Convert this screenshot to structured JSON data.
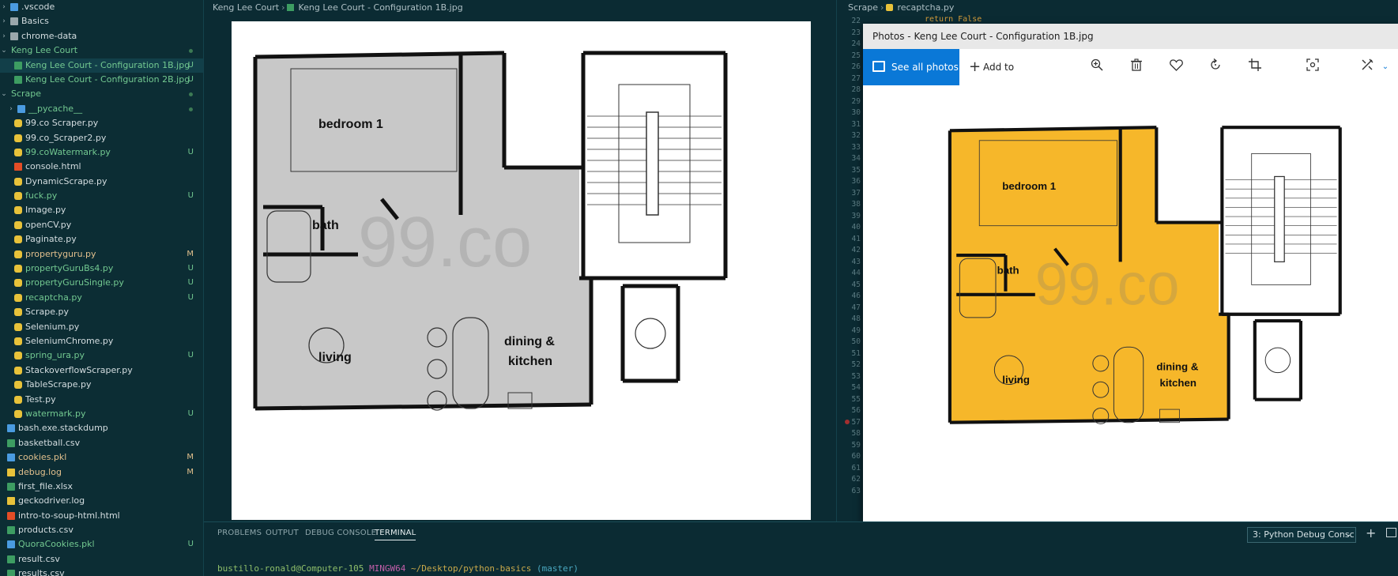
{
  "explorer": {
    "items": [
      {
        "label": ".vscode",
        "type": "folder",
        "collapsed": true,
        "indent": 0,
        "icon_color": "#4a9be0",
        "status": ""
      },
      {
        "label": "Basics",
        "type": "folder",
        "collapsed": true,
        "indent": 0,
        "icon_color": "#9aa7ab",
        "status": ""
      },
      {
        "label": "chrome-data",
        "type": "folder",
        "collapsed": true,
        "indent": 0,
        "icon_color": "#9aa7ab",
        "status": ""
      },
      {
        "label": "Keng Lee Court",
        "type": "folder",
        "collapsed": false,
        "indent": 0,
        "icon_color": "",
        "status": "dot"
      },
      {
        "label": "Keng Lee Court - Configuration 1B.jpg",
        "type": "image",
        "indent": 1,
        "icon_color": "#3d9d62",
        "status": "U",
        "selected": true
      },
      {
        "label": "Keng Lee Court - Configuration 2B.jpg",
        "type": "image",
        "indent": 1,
        "icon_color": "#3d9d62",
        "status": "U"
      },
      {
        "label": "Scrape",
        "type": "folder",
        "collapsed": false,
        "indent": 0,
        "icon_color": "",
        "status": "dot"
      },
      {
        "label": "__pycache__",
        "type": "folder",
        "collapsed": true,
        "indent": 1,
        "icon_color": "#4a9be0",
        "status": "dot"
      },
      {
        "label": "99.co Scraper.py",
        "type": "py",
        "indent": 1,
        "icon_color": "#e8c23a",
        "status": ""
      },
      {
        "label": "99.co_Scraper2.py",
        "type": "py",
        "indent": 1,
        "icon_color": "#e8c23a",
        "status": ""
      },
      {
        "label": "99.coWatermark.py",
        "type": "py",
        "indent": 1,
        "icon_color": "#e8c23a",
        "status": "U"
      },
      {
        "label": "console.html",
        "type": "html",
        "indent": 1,
        "icon_color": "#e44d26",
        "status": ""
      },
      {
        "label": "DynamicScrape.py",
        "type": "py",
        "indent": 1,
        "icon_color": "#e8c23a",
        "status": ""
      },
      {
        "label": "fuck.py",
        "type": "py",
        "indent": 1,
        "icon_color": "#e8c23a",
        "status": "U"
      },
      {
        "label": "Image.py",
        "type": "py",
        "indent": 1,
        "icon_color": "#e8c23a",
        "status": ""
      },
      {
        "label": "openCV.py",
        "type": "py",
        "indent": 1,
        "icon_color": "#e8c23a",
        "status": ""
      },
      {
        "label": "Paginate.py",
        "type": "py",
        "indent": 1,
        "icon_color": "#e8c23a",
        "status": ""
      },
      {
        "label": "propertyguru.py",
        "type": "py",
        "indent": 1,
        "icon_color": "#e8c23a",
        "status": "M"
      },
      {
        "label": "propertyGuruBs4.py",
        "type": "py",
        "indent": 1,
        "icon_color": "#e8c23a",
        "status": "U"
      },
      {
        "label": "propertyGuruSingle.py",
        "type": "py",
        "indent": 1,
        "icon_color": "#e8c23a",
        "status": "U"
      },
      {
        "label": "recaptcha.py",
        "type": "py",
        "indent": 1,
        "icon_color": "#e8c23a",
        "status": "U"
      },
      {
        "label": "Scrape.py",
        "type": "py",
        "indent": 1,
        "icon_color": "#e8c23a",
        "status": ""
      },
      {
        "label": "Selenium.py",
        "type": "py",
        "indent": 1,
        "icon_color": "#e8c23a",
        "status": ""
      },
      {
        "label": "SeleniumChrome.py",
        "type": "py",
        "indent": 1,
        "icon_color": "#e8c23a",
        "status": ""
      },
      {
        "label": "spring_ura.py",
        "type": "py",
        "indent": 1,
        "icon_color": "#e8c23a",
        "status": "U"
      },
      {
        "label": "StackoverflowScraper.py",
        "type": "py",
        "indent": 1,
        "icon_color": "#e8c23a",
        "status": ""
      },
      {
        "label": "TableScrape.py",
        "type": "py",
        "indent": 1,
        "icon_color": "#e8c23a",
        "status": ""
      },
      {
        "label": "Test.py",
        "type": "py",
        "indent": 1,
        "icon_color": "#e8c23a",
        "status": ""
      },
      {
        "label": "watermark.py",
        "type": "py",
        "indent": 1,
        "icon_color": "#e8c23a",
        "status": "U"
      },
      {
        "label": "bash.exe.stackdump",
        "type": "file",
        "indent": 0,
        "icon_color": "#4a9be0",
        "status": ""
      },
      {
        "label": "basketball.csv",
        "type": "csv",
        "indent": 0,
        "icon_color": "#3d9d62",
        "status": ""
      },
      {
        "label": "cookies.pkl",
        "type": "pkl",
        "indent": 0,
        "icon_color": "#4a9be0",
        "status": "M"
      },
      {
        "label": "debug.log",
        "type": "log",
        "indent": 0,
        "icon_color": "#e8c23a",
        "status": "M"
      },
      {
        "label": "first_file.xlsx",
        "type": "xlsx",
        "indent": 0,
        "icon_color": "#3d9d62",
        "status": ""
      },
      {
        "label": "geckodriver.log",
        "type": "log",
        "indent": 0,
        "icon_color": "#e8c23a",
        "status": ""
      },
      {
        "label": "intro-to-soup-html.html",
        "type": "html",
        "indent": 0,
        "icon_color": "#e44d26",
        "status": ""
      },
      {
        "label": "products.csv",
        "type": "csv",
        "indent": 0,
        "icon_color": "#3d9d62",
        "status": ""
      },
      {
        "label": "QuoraCookies.pkl",
        "type": "pkl",
        "indent": 0,
        "icon_color": "#4a9be0",
        "status": "U"
      },
      {
        "label": "result.csv",
        "type": "csv",
        "indent": 0,
        "icon_color": "#3d9d62",
        "status": ""
      },
      {
        "label": "results.csv",
        "type": "csv",
        "indent": 0,
        "icon_color": "#3d9d62",
        "status": ""
      }
    ]
  },
  "editor1": {
    "breadcrumb": [
      "Keng Lee Court",
      "Keng Lee Court - Configuration 1B.jpg"
    ],
    "floorplan": {
      "rooms": [
        "bedroom 1",
        "bath",
        "living",
        "dining &",
        "kitchen"
      ],
      "watermark": "99.co",
      "tint": "#c8c8c8"
    }
  },
  "editor2": {
    "breadcrumb": [
      "Scrape",
      "recaptcha.py"
    ],
    "code_snippet": "return False",
    "line_numbers": [
      "22",
      "23",
      "24",
      "25",
      "26",
      "27",
      "28",
      "29",
      "30",
      "31",
      "32",
      "33",
      "34",
      "35",
      "36",
      "37",
      "38",
      "39",
      "40",
      "41",
      "42",
      "43",
      "44",
      "45",
      "46",
      "47",
      "48",
      "49",
      "50",
      "51",
      "52",
      "53",
      "54",
      "55",
      "56",
      "57",
      "58",
      "59",
      "60",
      "61",
      "62",
      "63"
    ]
  },
  "photos": {
    "title": "Photos - Keng Lee Court - Configuration 1B.jpg",
    "see_all": "See all photos",
    "add_to": "Add to",
    "toolbar_icons": [
      "zoom-in-icon",
      "delete-icon",
      "favorite-icon",
      "rotate-icon",
      "crop-icon",
      "visual-search-icon",
      "edit-icon"
    ],
    "floorplan": {
      "rooms": [
        "bedroom 1",
        "bath",
        "living",
        "dining &",
        "kitchen"
      ],
      "watermark": "99.co",
      "tint": "#f6b72a"
    }
  },
  "panel": {
    "tabs": [
      "PROBLEMS",
      "OUTPUT",
      "DEBUG CONSOLE",
      "TERMINAL"
    ],
    "active_tab": "TERMINAL",
    "terminal_select": "3: Python Debug Consc",
    "prompt": {
      "user": "bustillo-ronald@Computer-105",
      "env": "MINGW64",
      "path": "~/Desktop/python-basics",
      "branch": "(master)"
    }
  },
  "colors": {
    "background": "#0b2b33",
    "accent_blue": "#0a78d7",
    "untracked": "#73c991",
    "modified": "#e2c08d"
  }
}
